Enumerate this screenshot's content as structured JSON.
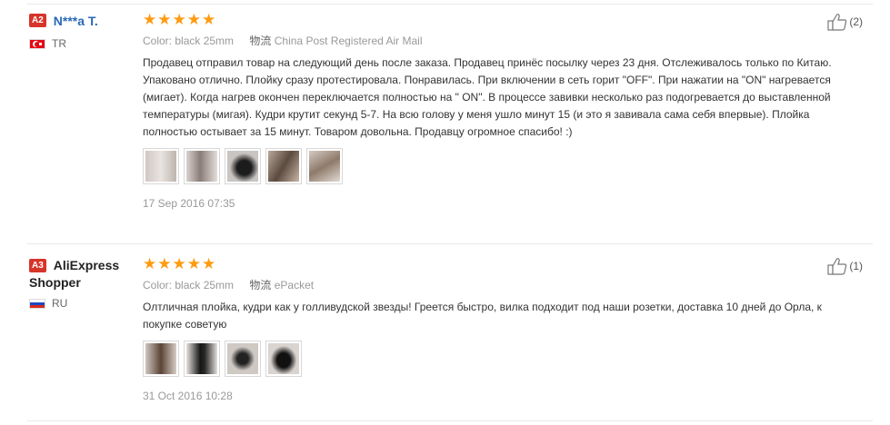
{
  "reviews": [
    {
      "level": "A2",
      "name": "N***a T.",
      "country_code": "TR",
      "rating": 5,
      "color_label": "Color:",
      "color_value": "black 25mm",
      "shipping_label": "物流",
      "shipping_value": "China Post Registered Air Mail",
      "text": "Продавец отправил товар на следующий день после заказа. Продавец принёс посылку через 23 дня. Отслеживалось только по Китаю. Упаковано отлично. Плойку сразу протестировала. Понравилась. При включении в сеть горит \"OFF\". При нажатии на \"ON\" нагревается (мигает). Когда нагрев окончен переключается полностью на \" ON\". В процессе завивки несколько раз подогревается до выставленной температуры (мигая). Кудри крутит секунд 5-7. На всю голову у меня ушло минут 15 (и это я завивала сама себя впервые). Плойка полностью остывает за 15 минут. Товаром довольна. Продавцу огромное спасибо! :)",
      "photo_count": 5,
      "date": "17 Sep 2016 07:35",
      "helpful": "(2)"
    },
    {
      "level": "A3",
      "name": "AliExpress Shopper",
      "country_code": "RU",
      "rating": 5,
      "color_label": "Color:",
      "color_value": "black 25mm",
      "shipping_label": "物流",
      "shipping_value": "ePacket",
      "text": "Олтличная плойка, кудри как у голливудской звезды! Греется быстро, вилка подходит под наши розетки, доставка 10 дней до Орла, к покупке советую",
      "photo_count": 4,
      "date": "31 Oct 2016 10:28",
      "helpful": "(1)"
    }
  ],
  "colors": {
    "name_link": "#2a69b7",
    "star": "#ff9b0f",
    "level_badge": "#d6352a",
    "muted": "#999999"
  },
  "icons": {
    "helpful": "thumbs-up-icon",
    "rating": "star-icon"
  }
}
